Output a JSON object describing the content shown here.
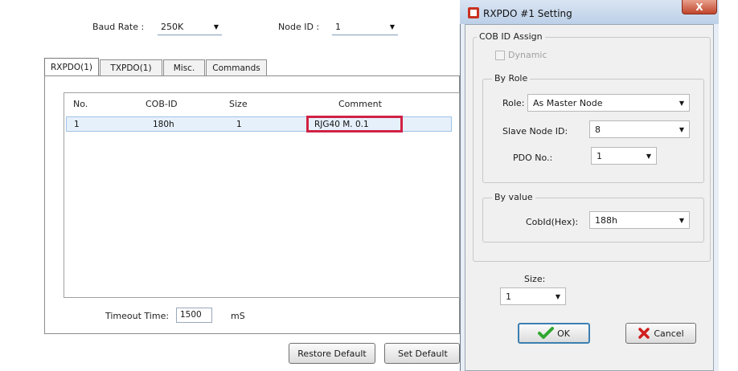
{
  "main": {
    "baud_label": "Baud Rate :",
    "baud_value": "250K",
    "node_label": "Node ID :",
    "node_value": "1",
    "tabs": [
      "RXPDO(1)",
      "TXPDO(1)",
      "Misc.",
      "Commands"
    ],
    "columns": [
      "No.",
      "COB-ID",
      "Size",
      "Comment"
    ],
    "rows": [
      {
        "no": "1",
        "cob_id": "180h",
        "size": "1",
        "comment": "RJG40 M. 0.1"
      }
    ],
    "timeout_label": "Timeout Time:",
    "timeout_value": "1500",
    "timeout_unit": "mS",
    "restore_btn": "Restore Default",
    "set_default_btn": "Set Default"
  },
  "dialog": {
    "title": "RXPDO #1 Setting",
    "close_glyph": "X",
    "cob_group": "COB ID Assign",
    "dynamic_label": "Dynamic",
    "by_role_group": "By Role",
    "role_label": "Role:",
    "role_value": "As Master Node",
    "slave_label": "Slave Node ID:",
    "slave_value": "8",
    "pdo_label": "PDO No.:",
    "pdo_value": "1",
    "by_value_group": "By value",
    "cobid_label": "CobId(Hex):",
    "cobid_value": "188h",
    "size_label": "Size:",
    "size_value": "1",
    "ok_btn": "OK",
    "cancel_btn": "Cancel"
  },
  "colors": {
    "highlight_border": "#d12244",
    "ok_check": "#2fa82f",
    "cancel_x": "#d01e1e"
  }
}
